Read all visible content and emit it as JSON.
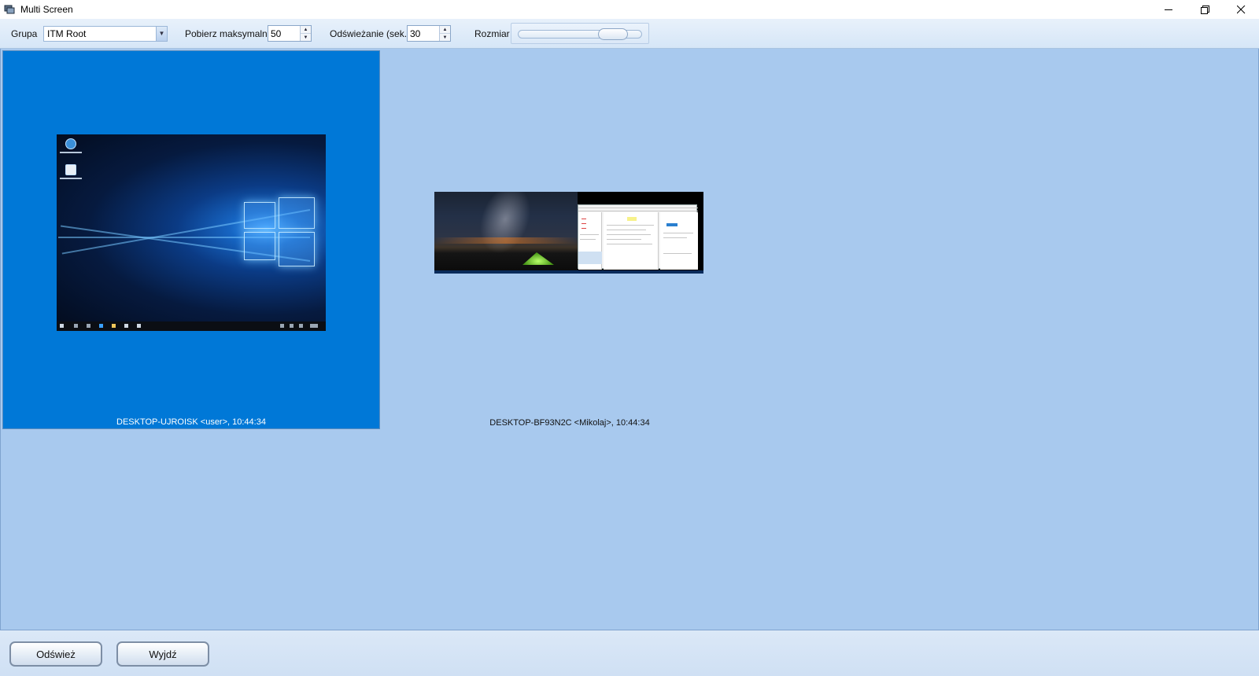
{
  "window": {
    "title": "Multi Screen",
    "controls": {
      "minimize": "—",
      "restore": "❐",
      "close": "✕"
    }
  },
  "toolbar": {
    "group_label": "Grupa",
    "group_value": "ITM Root",
    "max_label": "Pobierz maksymalnie",
    "max_value": "50",
    "refresh_label": "Odświeżanie (sek.)",
    "refresh_value": "30",
    "size_label": "Rozmiar",
    "size_level": 0.85
  },
  "screens": [
    {
      "caption": "DESKTOP-UJROISK <user>, 10:44:34",
      "selected": true
    },
    {
      "caption": "DESKTOP-BF93N2C <Mikolaj>, 10:44:34",
      "selected": false
    }
  ],
  "buttons": {
    "refresh": "Odśwież",
    "exit": "Wyjdź"
  },
  "colors": {
    "selected_tile": "#0078d7",
    "workspace": "#a8c9ee"
  }
}
